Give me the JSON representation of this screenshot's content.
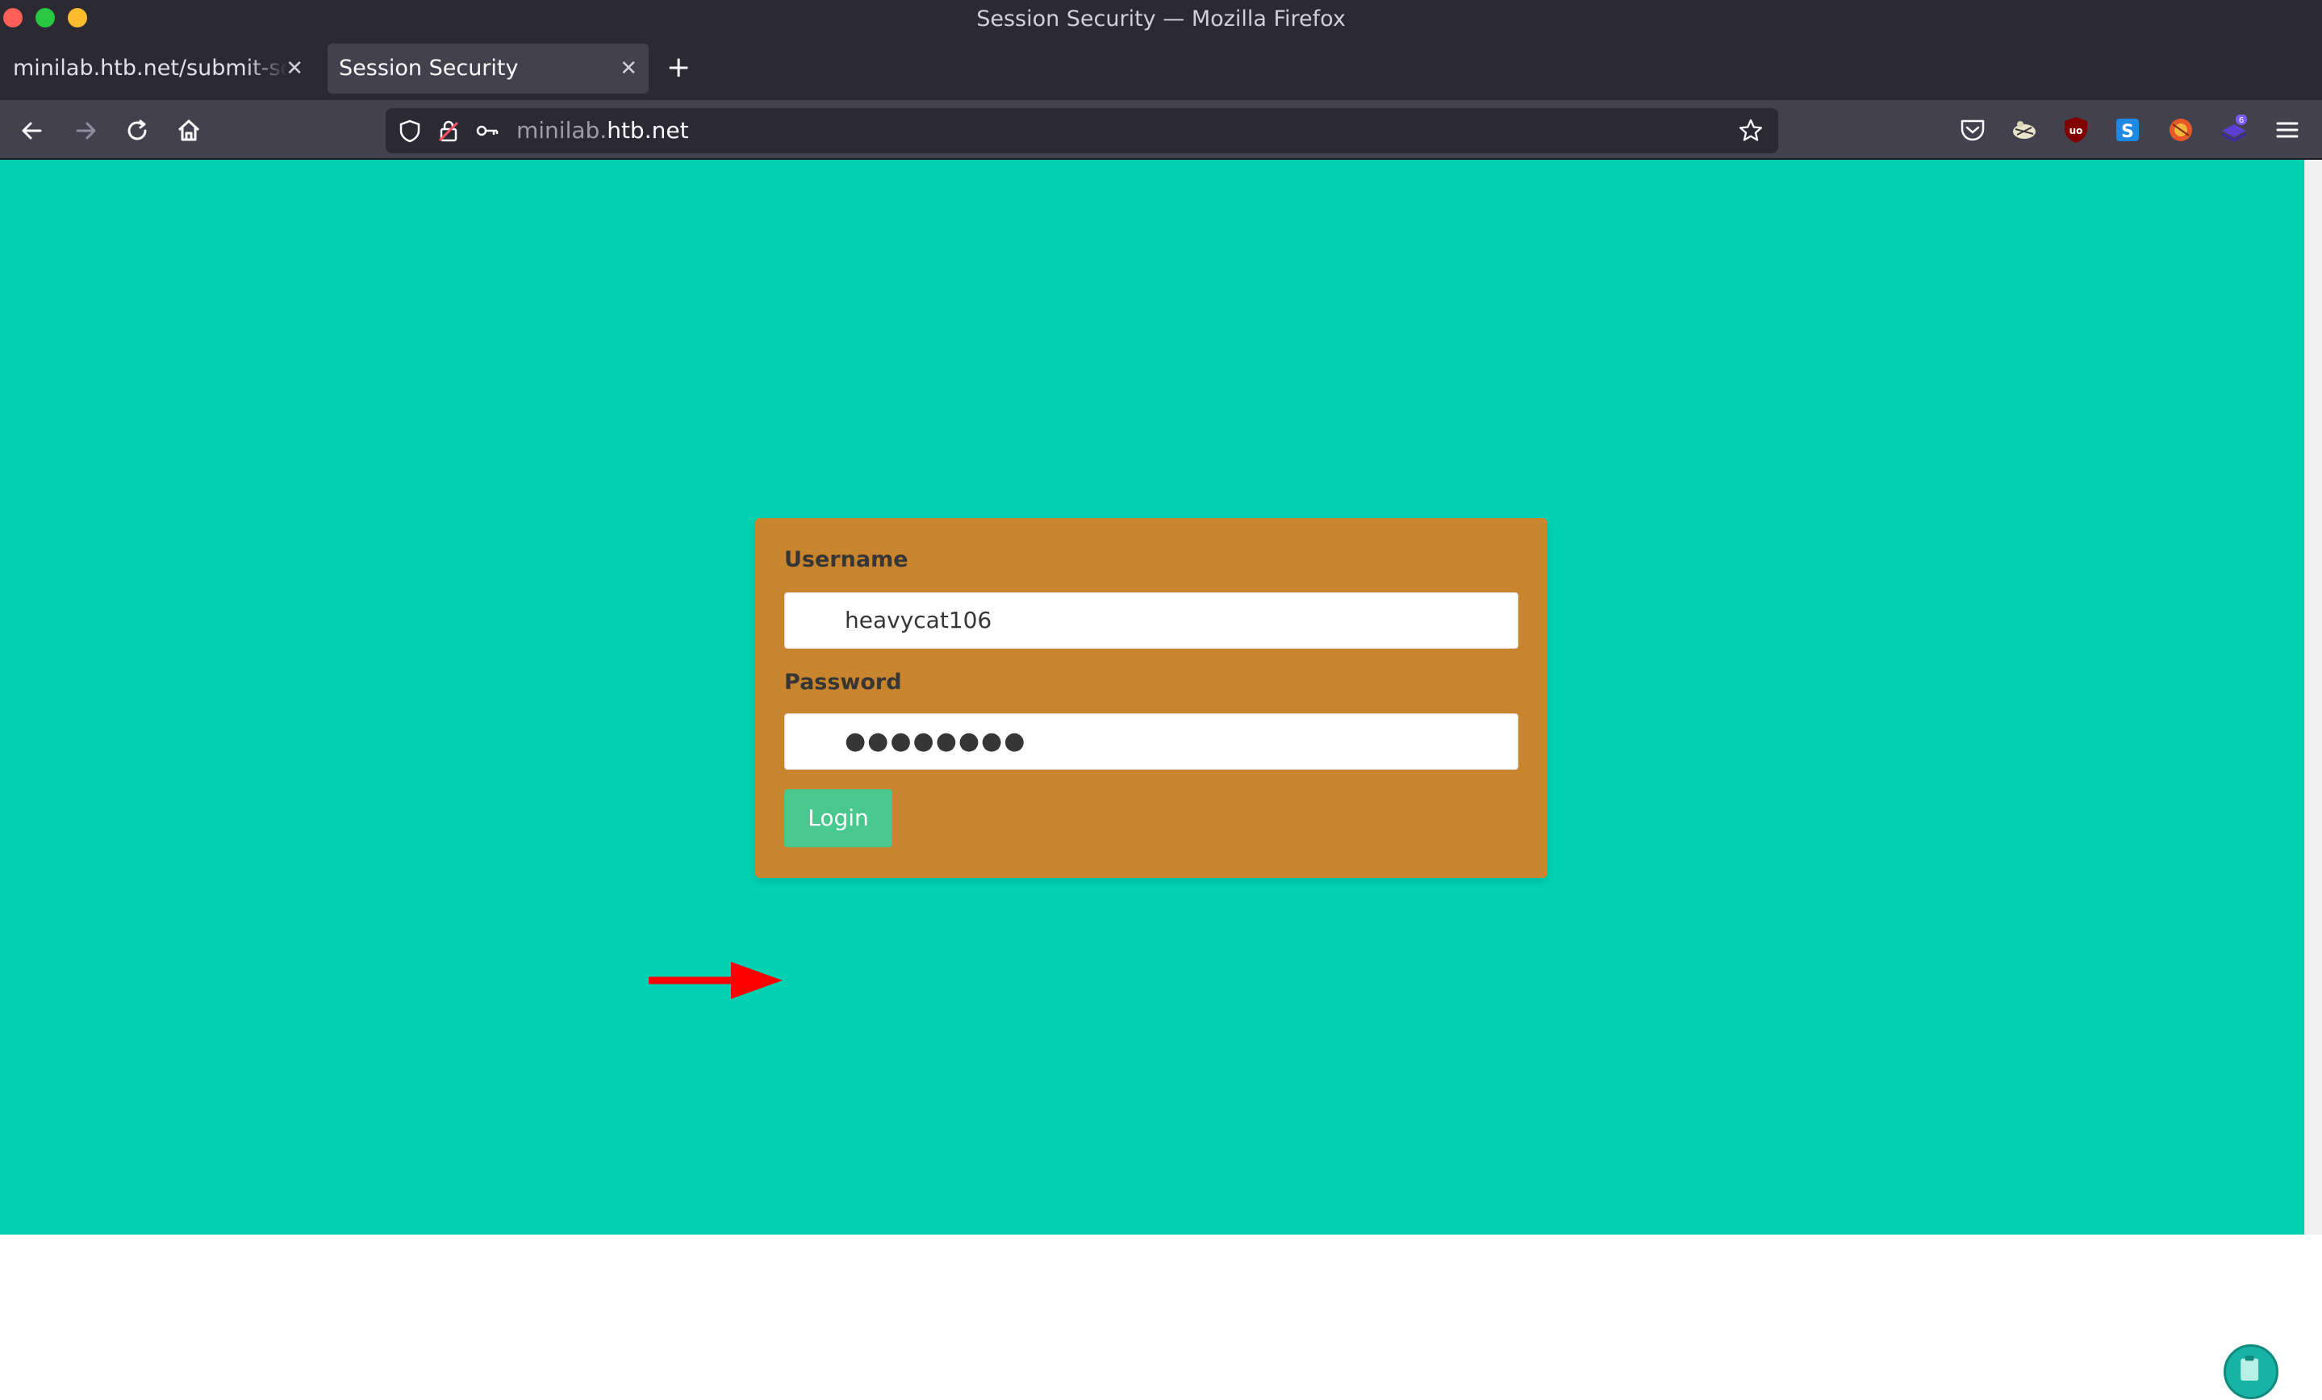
{
  "window": {
    "title": "Session Security — Mozilla Firefox"
  },
  "tabs": [
    {
      "label": "minilab.htb.net/submit-solut",
      "active": false
    },
    {
      "label": "Session Security",
      "active": true
    }
  ],
  "urlbar": {
    "host_prefix": "minilab.",
    "host_domain": "htb.net"
  },
  "extensions": {
    "ublock_badge": "",
    "notifications_count": "6"
  },
  "login_form": {
    "username_label": "Username",
    "username_value": "heavycat106",
    "password_label": "Password",
    "password_value": "●●●●●●●●",
    "login_button": "Login"
  },
  "colors": {
    "page_background": "#00d1b2",
    "card_background": "#c9852e",
    "login_button": "#48c78e",
    "annotation_arrow": "#ff0000"
  },
  "icons": [
    "back-icon",
    "forward-icon",
    "reload-icon",
    "home-icon",
    "shield-icon",
    "lock-insecure-icon",
    "key-icon",
    "bookmark-star-icon",
    "pocket-icon",
    "extension-icon",
    "ublock-icon",
    "s-extension-icon",
    "fox-extension-icon",
    "notification-extension-icon",
    "menu-icon",
    "clipboard-icon"
  ]
}
